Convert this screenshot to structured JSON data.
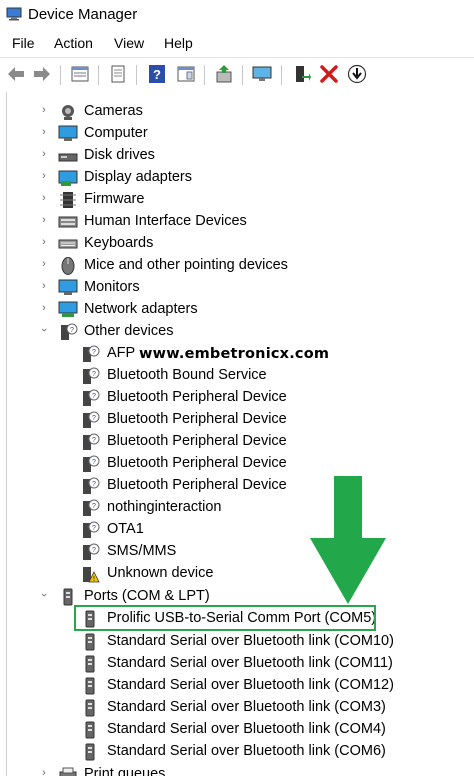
{
  "window": {
    "title": "Device Manager"
  },
  "menu": [
    "File",
    "Action",
    "View",
    "Help"
  ],
  "tree": [
    {
      "label": "Cameras",
      "expanded": false,
      "icon": "camera-icon"
    },
    {
      "label": "Computer",
      "expanded": false,
      "icon": "computer-icon"
    },
    {
      "label": "Disk drives",
      "expanded": false,
      "icon": "disk-drive-icon"
    },
    {
      "label": "Display adapters",
      "expanded": false,
      "icon": "display-adapter-icon"
    },
    {
      "label": "Firmware",
      "expanded": false,
      "icon": "firmware-icon"
    },
    {
      "label": "Human Interface Devices",
      "expanded": false,
      "icon": "hid-icon"
    },
    {
      "label": "Keyboards",
      "expanded": false,
      "icon": "keyboard-icon"
    },
    {
      "label": "Mice and other pointing devices",
      "expanded": false,
      "icon": "mouse-icon"
    },
    {
      "label": "Monitors",
      "expanded": false,
      "icon": "monitor-icon"
    },
    {
      "label": "Network adapters",
      "expanded": false,
      "icon": "network-adapter-icon"
    },
    {
      "label": "Other devices",
      "expanded": true,
      "icon": "unknown-device-icon",
      "children": [
        {
          "label": "AFP",
          "icon": "unknown-device-icon"
        },
        {
          "label": "Bluetooth Bound Service",
          "icon": "unknown-device-icon"
        },
        {
          "label": "Bluetooth Peripheral Device",
          "icon": "unknown-device-icon"
        },
        {
          "label": "Bluetooth Peripheral Device",
          "icon": "unknown-device-icon"
        },
        {
          "label": "Bluetooth Peripheral Device",
          "icon": "unknown-device-icon"
        },
        {
          "label": "Bluetooth Peripheral Device",
          "icon": "unknown-device-icon"
        },
        {
          "label": "Bluetooth Peripheral Device",
          "icon": "unknown-device-icon"
        },
        {
          "label": "nothinginteraction",
          "icon": "unknown-device-icon"
        },
        {
          "label": "OTA1",
          "icon": "unknown-device-icon"
        },
        {
          "label": "SMS/MMS",
          "icon": "unknown-device-icon"
        },
        {
          "label": "Unknown device",
          "icon": "warning-device-icon"
        }
      ]
    },
    {
      "label": "Ports (COM & LPT)",
      "expanded": true,
      "icon": "port-icon",
      "children": [
        {
          "label": "Prolific USB-to-Serial Comm Port (COM5)",
          "icon": "port-icon",
          "highlighted": true
        },
        {
          "label": "Standard Serial over Bluetooth link (COM10)",
          "icon": "port-icon"
        },
        {
          "label": "Standard Serial over Bluetooth link (COM11)",
          "icon": "port-icon"
        },
        {
          "label": "Standard Serial over Bluetooth link (COM12)",
          "icon": "port-icon"
        },
        {
          "label": "Standard Serial over Bluetooth link (COM3)",
          "icon": "port-icon"
        },
        {
          "label": "Standard Serial over Bluetooth link (COM4)",
          "icon": "port-icon"
        },
        {
          "label": "Standard Serial over Bluetooth link (COM6)",
          "icon": "port-icon"
        }
      ]
    },
    {
      "label": "Print queues",
      "expanded": false,
      "icon": "printer-icon"
    }
  ],
  "watermark": "www.embetronicx.com",
  "colors": {
    "highlight": "#2aa64a",
    "arrow": "#22a84a"
  }
}
